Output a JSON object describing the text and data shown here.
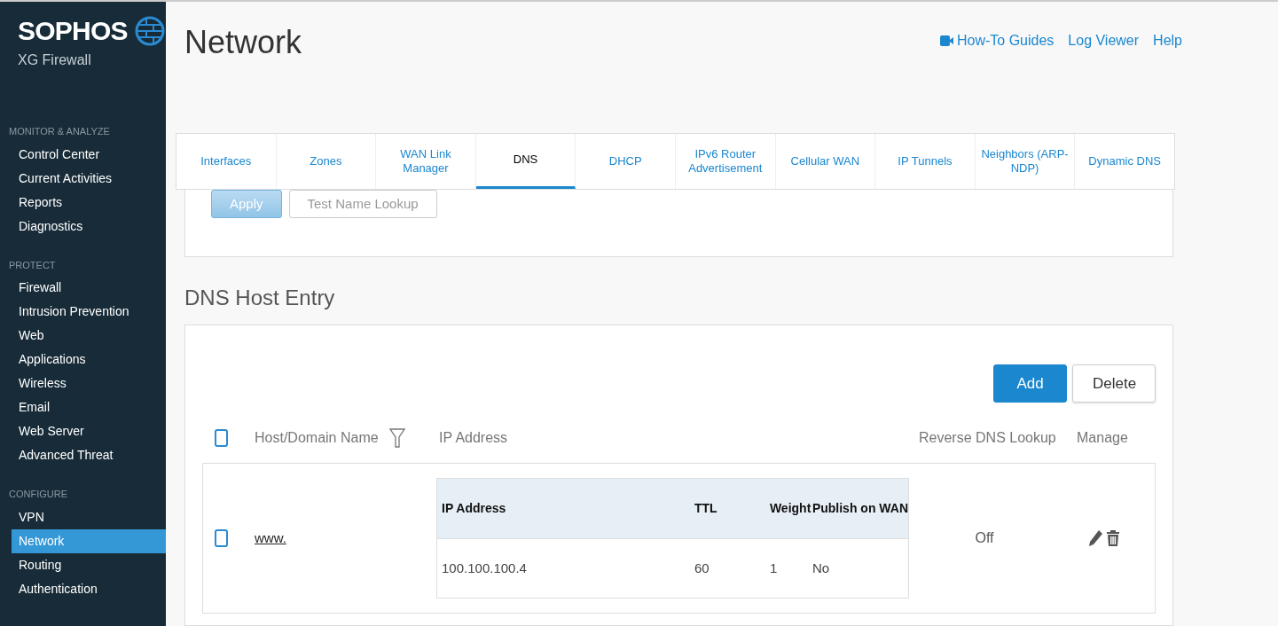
{
  "brand": {
    "name": "SOPHOS",
    "product": "XG Firewall"
  },
  "sidebar": {
    "sections": [
      {
        "title": "MONITOR & ANALYZE",
        "items": [
          {
            "label": "Control Center",
            "selected": false
          },
          {
            "label": "Current Activities",
            "selected": false
          },
          {
            "label": "Reports",
            "selected": false
          },
          {
            "label": "Diagnostics",
            "selected": false
          }
        ]
      },
      {
        "title": "PROTECT",
        "items": [
          {
            "label": "Firewall",
            "selected": false
          },
          {
            "label": "Intrusion Prevention",
            "selected": false
          },
          {
            "label": "Web",
            "selected": false
          },
          {
            "label": "Applications",
            "selected": false
          },
          {
            "label": "Wireless",
            "selected": false
          },
          {
            "label": "Email",
            "selected": false
          },
          {
            "label": "Web Server",
            "selected": false
          },
          {
            "label": "Advanced Threat",
            "selected": false
          }
        ]
      },
      {
        "title": "CONFIGURE",
        "items": [
          {
            "label": "VPN",
            "selected": false
          },
          {
            "label": "Network",
            "selected": true
          },
          {
            "label": "Routing",
            "selected": false
          },
          {
            "label": "Authentication",
            "selected": false
          }
        ]
      }
    ]
  },
  "page_title": "Network",
  "top_links": [
    {
      "label": "How-To Guides",
      "kind": "video"
    },
    {
      "label": "Log Viewer",
      "kind": "plain"
    },
    {
      "label": "Help",
      "kind": "plain"
    }
  ],
  "tabs": [
    {
      "label": "Interfaces",
      "selected": false
    },
    {
      "label": "Zones",
      "selected": false
    },
    {
      "label": "WAN Link Manager",
      "selected": false
    },
    {
      "label": "DNS",
      "selected": true
    },
    {
      "label": "DHCP",
      "selected": false
    },
    {
      "label": "IPv6 Router Advertisement",
      "selected": false
    },
    {
      "label": "Cellular WAN",
      "selected": false
    },
    {
      "label": "IP Tunnels",
      "selected": false
    },
    {
      "label": "Neighbors (ARP-NDP)",
      "selected": false
    },
    {
      "label": "Dynamic DNS",
      "selected": false
    }
  ],
  "dns_buttons": [
    {
      "label": "Apply",
      "kind": "primary",
      "disabled": true
    },
    {
      "label": "Test Name Lookup",
      "kind": "secondary",
      "disabled": true
    }
  ],
  "host_entry": {
    "title": "DNS Host Entry",
    "buttons": [
      {
        "label": "Add",
        "kind": "primary"
      },
      {
        "label": "Delete",
        "kind": "secondary"
      }
    ],
    "columns": [
      "Host/Domain Name",
      "IP Address",
      "Reverse DNS Lookup",
      "Manage"
    ],
    "select_all": {
      "checked": false
    },
    "rows": [
      {
        "checked": false,
        "host": "www.",
        "reverse_dns": "Off",
        "ip_table": {
          "columns": [
            "IP Address",
            "TTL",
            "Weight",
            "Publish on WAN"
          ],
          "rows": [
            [
              "100.100.100.4",
              "60",
              "1",
              "No"
            ]
          ]
        }
      }
    ]
  }
}
